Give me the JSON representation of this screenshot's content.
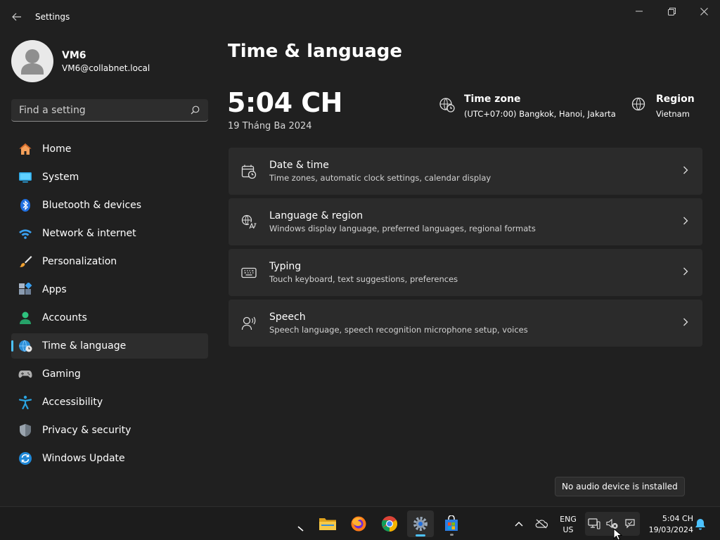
{
  "window": {
    "title": "Settings"
  },
  "profile": {
    "name": "VM6",
    "email": "VM6@collabnet.local"
  },
  "search": {
    "placeholder": "Find a setting"
  },
  "nav": {
    "items": [
      {
        "label": "Home",
        "icon": "home-icon"
      },
      {
        "label": "System",
        "icon": "system-icon"
      },
      {
        "label": "Bluetooth & devices",
        "icon": "bluetooth-icon"
      },
      {
        "label": "Network & internet",
        "icon": "wifi-icon"
      },
      {
        "label": "Personalization",
        "icon": "brush-icon"
      },
      {
        "label": "Apps",
        "icon": "apps-icon"
      },
      {
        "label": "Accounts",
        "icon": "accounts-icon"
      },
      {
        "label": "Time & language",
        "icon": "globe-clock-icon",
        "active": true
      },
      {
        "label": "Gaming",
        "icon": "gamepad-icon"
      },
      {
        "label": "Accessibility",
        "icon": "accessibility-icon"
      },
      {
        "label": "Privacy & security",
        "icon": "shield-icon"
      },
      {
        "label": "Windows Update",
        "icon": "update-icon"
      }
    ]
  },
  "main": {
    "title": "Time & language",
    "time": "5:04 CH",
    "date": "19 Tháng Ba 2024",
    "timezone": {
      "title": "Time zone",
      "value": "(UTC+07:00) Bangkok, Hanoi, Jakarta"
    },
    "region": {
      "title": "Region",
      "value": "Vietnam"
    },
    "cards": [
      {
        "title": "Date & time",
        "subtitle": "Time zones, automatic clock settings, calendar display",
        "icon": "calendar-clock-icon"
      },
      {
        "title": "Language & region",
        "subtitle": "Windows display language, preferred languages, regional formats",
        "icon": "language-icon"
      },
      {
        "title": "Typing",
        "subtitle": "Touch keyboard, text suggestions, preferences",
        "icon": "keyboard-icon"
      },
      {
        "title": "Speech",
        "subtitle": "Speech language, speech recognition microphone setup, voices",
        "icon": "speech-icon"
      }
    ]
  },
  "tooltip": {
    "text": "No audio device is installed"
  },
  "taskbar": {
    "lang_line1": "ENG",
    "lang_line2": "US",
    "clock_time": "5:04 CH",
    "clock_date": "19/03/2024"
  },
  "colors": {
    "accent": "#4cc2ff",
    "background": "#202020",
    "card": "#2b2b2b"
  }
}
